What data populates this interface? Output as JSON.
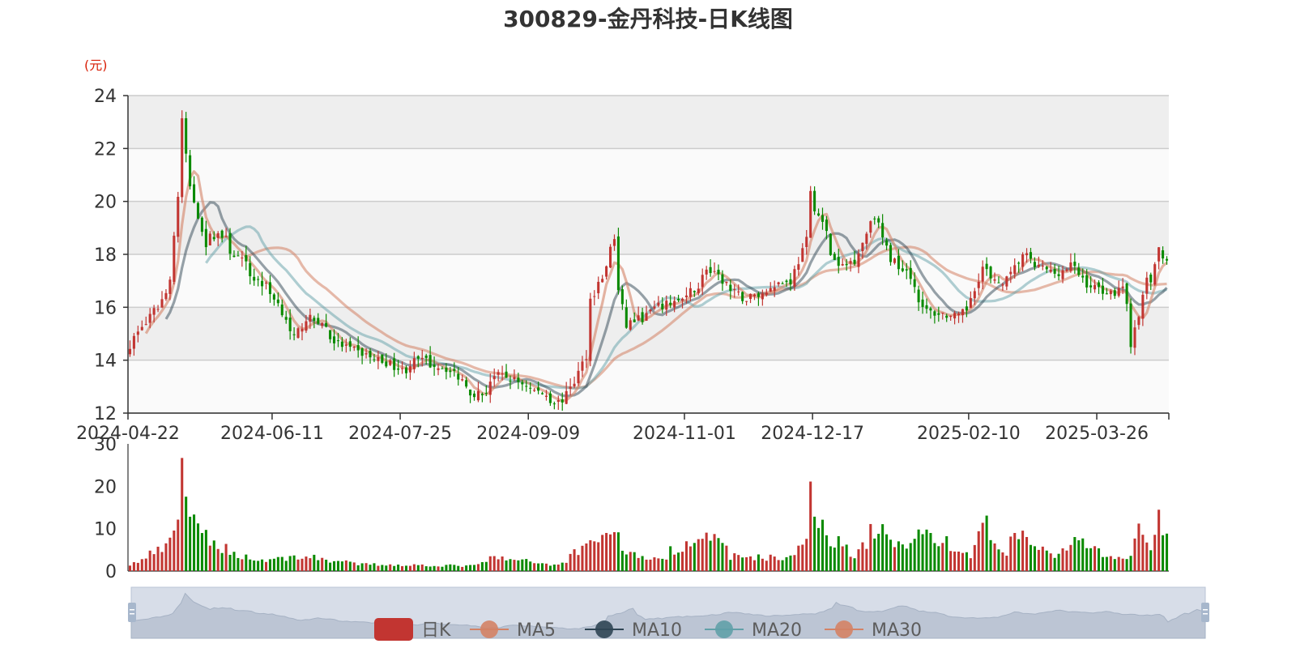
{
  "chart_data": {
    "type": "candlestick",
    "title": "300829-金丹科技-日K线图",
    "y_unit": "(元)",
    "colors": {
      "up": "#c23531",
      "down": "#0b8a00",
      "ma5": "#d48265",
      "ma10": "#2f4554",
      "ma20": "#61a0a8",
      "ma30": "#d48265"
    },
    "price_axis": {
      "ylim": [
        12,
        24
      ],
      "ticks": [
        12,
        14,
        16,
        18,
        20,
        22,
        24
      ]
    },
    "volume_axis": {
      "ylim": [
        0,
        30
      ],
      "ticks": [
        0,
        10,
        20,
        30
      ]
    },
    "x_ticks": [
      "2024-04-22",
      "2024-06-11",
      "2024-07-25",
      "2024-09-09",
      "2024-11-01",
      "2024-12-17",
      "2025-02-10",
      "2025-03-26"
    ],
    "date_range": [
      "2024-04-22",
      "2025-04-18"
    ],
    "legend": [
      "日K",
      "MA5",
      "MA10",
      "MA20",
      "MA30"
    ],
    "close_anchors": [
      [
        "2024-04-22",
        14.6
      ],
      [
        "2024-04-25",
        15.3
      ],
      [
        "2024-04-29",
        15.6
      ],
      [
        "2024-05-06",
        17.2
      ],
      [
        "2024-05-08",
        20.2
      ],
      [
        "2024-05-09",
        23.0
      ],
      [
        "2024-05-10",
        21.8
      ],
      [
        "2024-05-13",
        20.5
      ],
      [
        "2024-05-15",
        19.5
      ],
      [
        "2024-05-17",
        18.4
      ],
      [
        "2024-05-22",
        18.8
      ],
      [
        "2024-05-28",
        18.0
      ],
      [
        "2024-06-03",
        17.2
      ],
      [
        "2024-06-07",
        16.8
      ],
      [
        "2024-06-11",
        16.4
      ],
      [
        "2024-06-14",
        15.6
      ],
      [
        "2024-06-18",
        14.8
      ],
      [
        "2024-06-21",
        15.6
      ],
      [
        "2024-06-26",
        15.5
      ],
      [
        "2024-07-03",
        14.6
      ],
      [
        "2024-07-10",
        14.3
      ],
      [
        "2024-07-17",
        14.0
      ],
      [
        "2024-07-23",
        13.8
      ],
      [
        "2024-07-25",
        13.6
      ],
      [
        "2024-07-31",
        14.0
      ],
      [
        "2024-08-07",
        13.8
      ],
      [
        "2024-08-13",
        13.5
      ],
      [
        "2024-08-19",
        12.8
      ],
      [
        "2024-08-22",
        12.7
      ],
      [
        "2024-08-27",
        13.4
      ],
      [
        "2024-09-02",
        13.3
      ],
      [
        "2024-09-09",
        12.9
      ],
      [
        "2024-09-13",
        12.7
      ],
      [
        "2024-09-18",
        12.4
      ],
      [
        "2024-09-24",
        13.2
      ],
      [
        "2024-09-27",
        14.2
      ],
      [
        "2024-09-30",
        16.3
      ],
      [
        "2024-10-08",
        18.6
      ],
      [
        "2024-10-09",
        16.6
      ],
      [
        "2024-10-11",
        15.3
      ],
      [
        "2024-10-17",
        15.6
      ],
      [
        "2024-10-23",
        16.0
      ],
      [
        "2024-10-28",
        16.2
      ],
      [
        "2024-11-01",
        16.3
      ],
      [
        "2024-11-06",
        16.8
      ],
      [
        "2024-11-08",
        17.5
      ],
      [
        "2024-11-12",
        17.2
      ],
      [
        "2024-11-18",
        16.6
      ],
      [
        "2024-11-22",
        16.3
      ],
      [
        "2024-11-28",
        16.5
      ],
      [
        "2024-12-03",
        16.9
      ],
      [
        "2024-12-09",
        17.0
      ],
      [
        "2024-12-13",
        18.5
      ],
      [
        "2024-12-16",
        20.3
      ],
      [
        "2024-12-17",
        19.8
      ],
      [
        "2024-12-20",
        18.8
      ],
      [
        "2024-12-25",
        17.5
      ],
      [
        "2024-12-31",
        17.8
      ],
      [
        "2025-01-03",
        18.8
      ],
      [
        "2025-01-07",
        19.5
      ],
      [
        "2025-01-10",
        18.2
      ],
      [
        "2025-01-15",
        17.6
      ],
      [
        "2025-01-20",
        17.2
      ],
      [
        "2025-01-23",
        15.9
      ],
      [
        "2025-02-05",
        15.6
      ],
      [
        "2025-02-10",
        16.4
      ],
      [
        "2025-02-13",
        17.5
      ],
      [
        "2025-02-18",
        16.9
      ],
      [
        "2025-02-24",
        17.2
      ],
      [
        "2025-02-27",
        18.0
      ],
      [
        "2025-03-05",
        17.5
      ],
      [
        "2025-03-11",
        17.3
      ],
      [
        "2025-03-17",
        17.6
      ],
      [
        "2025-03-21",
        16.9
      ],
      [
        "2025-03-26",
        16.7
      ],
      [
        "2025-03-31",
        16.5
      ],
      [
        "2025-04-03",
        16.8
      ],
      [
        "2025-04-07",
        14.6
      ],
      [
        "2025-04-09",
        15.6
      ],
      [
        "2025-04-11",
        17.2
      ],
      [
        "2025-04-14",
        16.8
      ],
      [
        "2025-04-16",
        18.2
      ],
      [
        "2025-04-18",
        17.8
      ]
    ],
    "volume_anchors": [
      [
        "2024-04-22",
        1.5
      ],
      [
        "2024-05-06",
        6.5
      ],
      [
        "2024-05-08",
        14
      ],
      [
        "2024-05-09",
        25
      ],
      [
        "2024-05-10",
        18.5
      ],
      [
        "2024-05-13",
        14
      ],
      [
        "2024-05-15",
        9
      ],
      [
        "2024-05-22",
        6
      ],
      [
        "2024-05-28",
        4
      ],
      [
        "2024-06-05",
        2.5
      ],
      [
        "2024-06-21",
        3.5
      ],
      [
        "2024-07-10",
        1.6
      ],
      [
        "2024-08-20",
        1.2
      ],
      [
        "2024-08-26",
        3.2
      ],
      [
        "2024-09-18",
        1.4
      ],
      [
        "2024-09-30",
        7.5
      ],
      [
        "2024-10-08",
        9.5
      ],
      [
        "2024-10-11",
        4.5
      ],
      [
        "2024-10-23",
        2.5
      ],
      [
        "2024-11-08",
        9.5
      ],
      [
        "2024-11-18",
        3.5
      ],
      [
        "2024-12-09",
        3
      ],
      [
        "2024-12-13",
        8
      ],
      [
        "2024-12-16",
        20.5
      ],
      [
        "2024-12-17",
        15.5
      ],
      [
        "2024-12-20",
        9
      ],
      [
        "2024-12-31",
        4
      ],
      [
        "2025-01-07",
        10
      ],
      [
        "2025-01-15",
        6
      ],
      [
        "2025-01-23",
        9.5
      ],
      [
        "2025-02-10",
        3
      ],
      [
        "2025-02-13",
        12.5
      ],
      [
        "2025-02-20",
        4
      ],
      [
        "2025-02-27",
        8.5
      ],
      [
        "2025-03-11",
        3
      ],
      [
        "2025-03-17",
        7
      ],
      [
        "2025-04-03",
        2.5
      ],
      [
        "2025-04-07",
        4.5
      ],
      [
        "2025-04-09",
        9.5
      ],
      [
        "2025-04-11",
        7.5
      ],
      [
        "2025-04-14",
        4
      ],
      [
        "2025-04-16",
        14.5
      ],
      [
        "2025-04-18",
        8
      ]
    ]
  }
}
